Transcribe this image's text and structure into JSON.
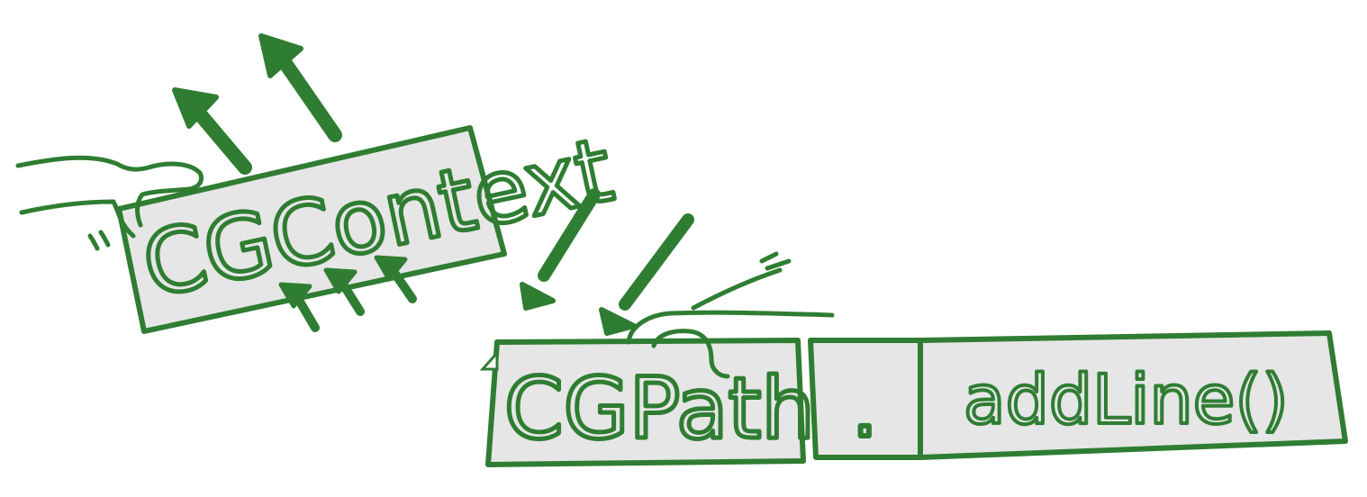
{
  "colors": {
    "ink": "#2f7d32",
    "box_fill": "#e6e6e6",
    "background": "#ffffff"
  },
  "context_block": {
    "label": "CGContext"
  },
  "path_block": {
    "label": "CGPath"
  },
  "dot_block": {
    "label": "."
  },
  "method_block": {
    "label": "addLine()"
  }
}
